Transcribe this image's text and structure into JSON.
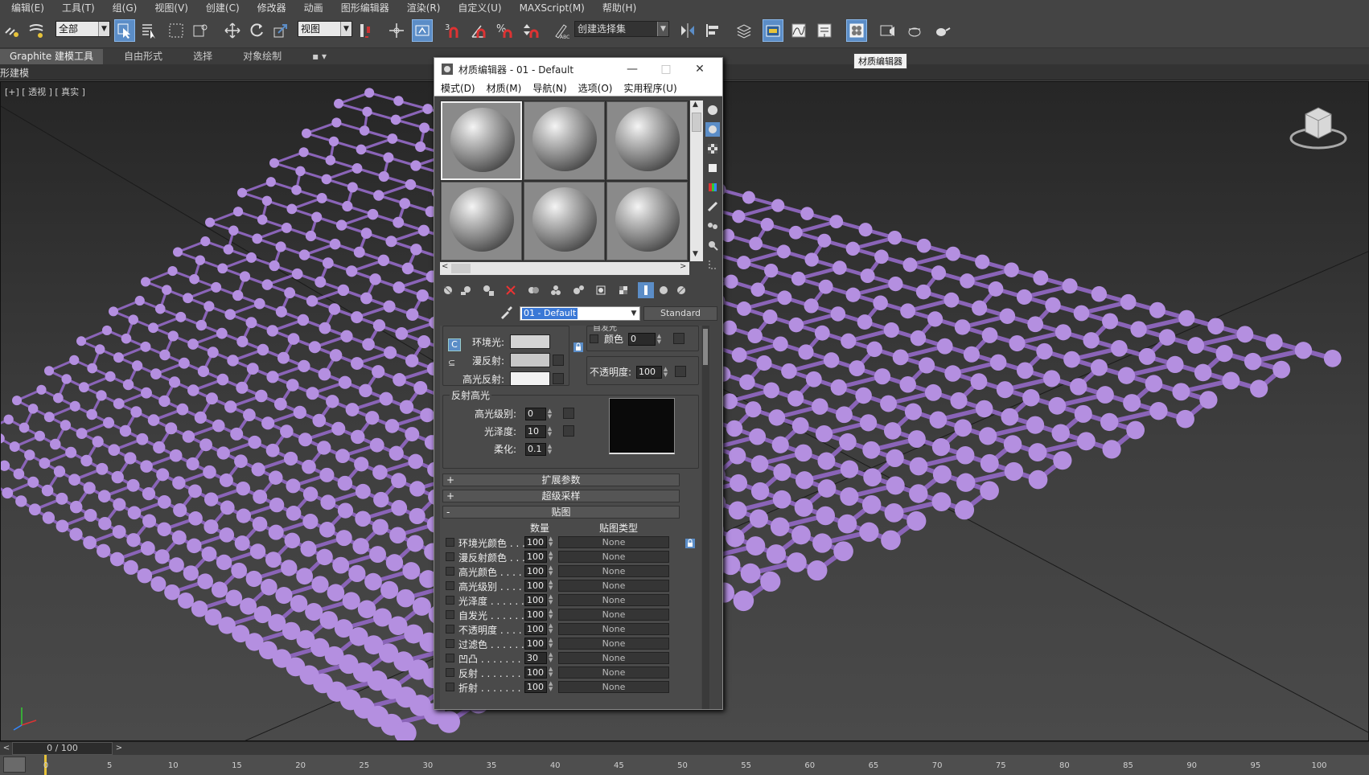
{
  "menu": [
    "编辑(E)",
    "工具(T)",
    "组(G)",
    "视图(V)",
    "创建(C)",
    "修改器",
    "动画",
    "图形编辑器",
    "渲染(R)",
    "自定义(U)",
    "MAXScript(M)",
    "帮助(H)"
  ],
  "toolbar": {
    "filter_value": "全部",
    "coord_value": "视图",
    "selection_set_value": "创建选择集",
    "snap_3": "3",
    "percent_label": "%"
  },
  "ribbon": {
    "tabs": [
      "Graphite 建模工具",
      "自由形式",
      "选择",
      "对象绘制"
    ],
    "sub_label": "形建模"
  },
  "tooltip": "材质编辑器",
  "viewport": {
    "label": "[+] [ 透视 ] [ 真实 ]"
  },
  "timeline": {
    "position": "0 / 100",
    "ticks": [
      "0",
      "5",
      "10",
      "15",
      "20",
      "25",
      "30",
      "35",
      "40",
      "45",
      "50",
      "55",
      "60",
      "65",
      "70",
      "75",
      "80",
      "85",
      "90",
      "95",
      "100"
    ]
  },
  "material_editor": {
    "title": "材质编辑器 - 01 - Default",
    "menus": [
      "模式(D)",
      "材质(M)",
      "导航(N)",
      "选项(O)",
      "实用程序(U)"
    ],
    "material_name": "01 - Default",
    "material_type": "Standard",
    "basic": {
      "ambient_label": "环境光:",
      "diffuse_label": "漫反射:",
      "specular_label": "高光反射:",
      "lock_letter": "C",
      "ambient_color": "#d4d4d4",
      "diffuse_color": "#c8c8c8",
      "specular_color": "#f2f2f2"
    },
    "self_illum": {
      "group": "自发光",
      "color_label": "颜色",
      "value": "0"
    },
    "opacity": {
      "label": "不透明度:",
      "value": "100"
    },
    "spec_highlight": {
      "group": "反射高光",
      "level_label": "高光级别:",
      "level": "0",
      "gloss_label": "光泽度:",
      "gloss": "10",
      "soften_label": "柔化:",
      "soften": "0.1"
    },
    "rollouts": [
      {
        "sign": "+",
        "label": "扩展参数"
      },
      {
        "sign": "+",
        "label": "超级采样"
      },
      {
        "sign": "-",
        "label": "贴图"
      }
    ],
    "maps_header": {
      "amount": "数量",
      "type": "贴图类型"
    },
    "maps": [
      {
        "label": "环境光颜色 . . .",
        "amount": "100",
        "type": "None"
      },
      {
        "label": "漫反射颜色 . . .",
        "amount": "100",
        "type": "None"
      },
      {
        "label": "高光颜色 . . . .",
        "amount": "100",
        "type": "None"
      },
      {
        "label": "高光级别 . . . .",
        "amount": "100",
        "type": "None"
      },
      {
        "label": "光泽度 . . . . . .",
        "amount": "100",
        "type": "None"
      },
      {
        "label": "自发光 . . . . . .",
        "amount": "100",
        "type": "None"
      },
      {
        "label": "不透明度 . . . .",
        "amount": "100",
        "type": "None"
      },
      {
        "label": "过滤色 . . . . . .",
        "amount": "100",
        "type": "None"
      },
      {
        "label": "凹凸 . . . . . . . .",
        "amount": "30",
        "type": "None"
      },
      {
        "label": "反射 . . . . . . . .",
        "amount": "100",
        "type": "None"
      },
      {
        "label": "折射 . . . . . . . .",
        "amount": "100",
        "type": "None"
      }
    ]
  },
  "colors": {
    "accent": "#5b8dc7",
    "mesh": "#b48fe0",
    "mesh_dark": "#8a64b8"
  }
}
